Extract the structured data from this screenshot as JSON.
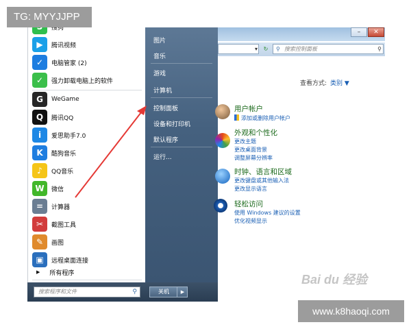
{
  "watermark": {
    "top_left": "TG: MYYJJPP",
    "bottom_right": "www.k8haoqi.com",
    "baidu": "Bai du 经验"
  },
  "start_menu": {
    "programs": [
      {
        "label": "搜狗",
        "color": "#2fbf4d",
        "glyph": "S"
      },
      {
        "label": "腾讯视频",
        "color": "#1aa0e8",
        "glyph": "▶"
      },
      {
        "label": "电脑管家 (2)",
        "color": "#1d7de0",
        "glyph": "✓"
      },
      {
        "label": "强力卸载电脑上的软件",
        "color": "#3bbf4a",
        "glyph": "✓"
      },
      {
        "label": "WeGame",
        "color": "#262626",
        "glyph": "G"
      },
      {
        "label": "腾讯QQ",
        "color": "#111111",
        "glyph": "Q"
      },
      {
        "label": "爱思助手7.0",
        "color": "#1e88e5",
        "glyph": "i"
      },
      {
        "label": "酷狗音乐",
        "color": "#1f7ee0",
        "glyph": "K"
      },
      {
        "label": "QQ音乐",
        "color": "#f5c518",
        "glyph": "♪"
      },
      {
        "label": "微信",
        "color": "#42b72a",
        "glyph": "W"
      },
      {
        "label": "计算器",
        "color": "#6b7e93",
        "glyph": "="
      },
      {
        "label": "截图工具",
        "color": "#d23c3c",
        "glyph": "✂"
      },
      {
        "label": "画图",
        "color": "#e08a2c",
        "glyph": "✎"
      },
      {
        "label": "远程桌面连接",
        "color": "#2a6fbd",
        "glyph": "▣"
      }
    ],
    "all_programs": "所有程序",
    "search_placeholder": "搜索程序和文件",
    "shutdown": "关机",
    "right_links": [
      "图片",
      "音乐",
      "游戏",
      "计算机",
      "控制面板",
      "设备和打印机",
      "默认程序",
      "运行..."
    ]
  },
  "control_panel": {
    "search_placeholder": "搜索控制面板",
    "view_by_label": "查看方式:",
    "view_by_value": "类别 ▼",
    "categories": [
      {
        "title": "用户帐户",
        "links": [
          "添加或删除用户帐户"
        ]
      },
      {
        "title": "外观和个性化",
        "links": [
          "更改主题",
          "更改桌面背景",
          "调整屏幕分辨率"
        ]
      },
      {
        "title": "时钟、语言和区域",
        "links": [
          "更改键盘或其他输入法",
          "更改显示语言"
        ]
      },
      {
        "title": "轻松访问",
        "links": [
          "使用 Windows 建议的设置",
          "优化视频显示"
        ]
      }
    ]
  },
  "colors": {
    "arrow": "#e53935",
    "link": "#1a5fb4",
    "category": "#1c6a1c"
  }
}
